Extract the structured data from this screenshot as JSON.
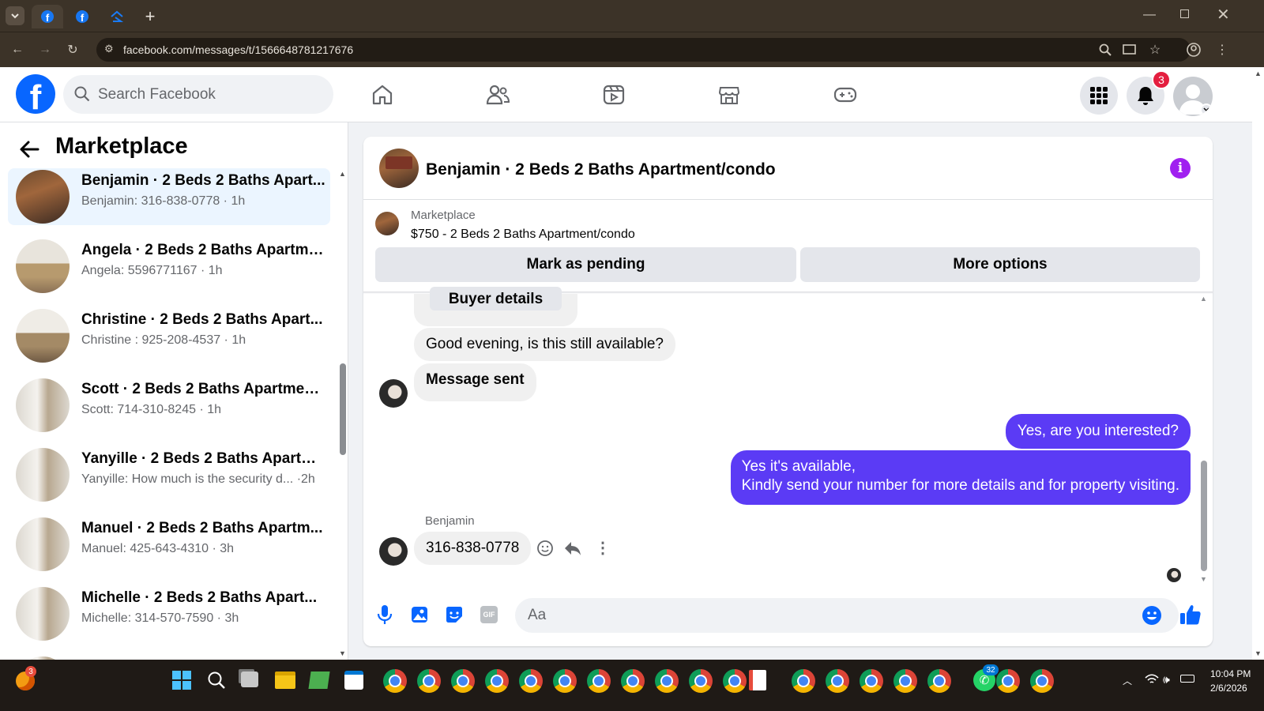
{
  "browser": {
    "url": "facebook.com/messages/t/1566648781217676",
    "new_tab": "+"
  },
  "header": {
    "search_placeholder": "Search Facebook",
    "notification_count": "3",
    "nav_icons": [
      "home-icon",
      "friends-icon",
      "watch-icon",
      "marketplace-icon",
      "gaming-icon"
    ]
  },
  "sidebar": {
    "title": "Marketplace",
    "conversations": [
      {
        "title": "Benjamin · 2 Beds 2 Baths Apart...",
        "preview": "Benjamin: 316-838-0778 · 1h"
      },
      {
        "title": "Angela · 2 Beds 2 Baths Apartme...",
        "preview": "Angela: 5596771167 · 1h"
      },
      {
        "title": "Christine · 2 Beds 2 Baths Apart...",
        "preview": "Christine : 925-208-4537 · 1h"
      },
      {
        "title": "Scott · 2 Beds 2 Baths Apartment...",
        "preview": "Scott: 714-310-8245 · 1h"
      },
      {
        "title": "Yanyille · 2 Beds 2 Baths Apartm...",
        "preview": "Yanyille: How much is the security d... ·2h"
      },
      {
        "title": "Manuel · 2 Beds 2 Baths Apartm...",
        "preview": "Manuel: 425-643-4310 · 3h"
      },
      {
        "title": "Michelle · 2 Beds 2 Baths Apart...",
        "preview": "Michelle: 314-570-7590 · 3h"
      }
    ]
  },
  "chat": {
    "title": "Benjamin · 2 Beds 2 Baths Apartment/condo",
    "listing_source": "Marketplace",
    "listing_title": "$750 - 2 Beds 2 Baths Apartment/condo",
    "mark_pending": "Mark as pending",
    "more_options": "More options",
    "buyer_details": "Buyer details",
    "messages": {
      "in1": "Good evening, is this still available?",
      "in2": "Message sent",
      "out1": "Yes, are you interested?",
      "out2_line1": "Yes it's available,",
      "out2_line2": "Kindly send your number for more details and for property visiting.",
      "sender_name": "Benjamin",
      "in3": "316-838-0778"
    },
    "composer_placeholder": "Aa"
  },
  "taskbar": {
    "time": "10:04 PM",
    "date": "2/6/2026",
    "weather_badge": "3",
    "whatsapp_badge": "32"
  }
}
